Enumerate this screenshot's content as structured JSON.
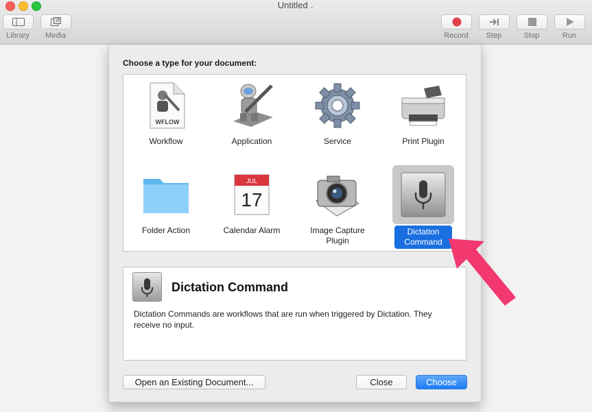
{
  "window": {
    "title": "Untitled"
  },
  "toolbar": {
    "library_label": "Library",
    "media_label": "Media",
    "record_label": "Record",
    "step_label": "Step",
    "stop_label": "Stop",
    "run_label": "Run"
  },
  "dialog": {
    "prompt": "Choose a type for your document:",
    "types": [
      {
        "label": "Workflow",
        "icon": "workflow-file-icon"
      },
      {
        "label": "Application",
        "icon": "automator-robot-icon"
      },
      {
        "label": "Service",
        "icon": "gear-icon"
      },
      {
        "label": "Print Plugin",
        "icon": "printer-icon"
      },
      {
        "label": "Folder Action",
        "icon": "folder-icon"
      },
      {
        "label": "Calendar Alarm",
        "icon": "calendar-icon",
        "month": "JUL",
        "day": "17"
      },
      {
        "label_line1": "Image Capture",
        "label_line2": "Plugin",
        "icon": "camera-icon"
      },
      {
        "label_line1": "Dictation",
        "label_line2": "Command",
        "icon": "microphone-icon",
        "selected": true
      }
    ],
    "description": {
      "title": "Dictation Command",
      "text": "Dictation Commands are workflows that are run when triggered by Dictation. They receive no input."
    },
    "buttons": {
      "open_existing": "Open an Existing Document...",
      "close": "Close",
      "choose": "Choose"
    }
  },
  "colors": {
    "accent": "#1a6fe0",
    "annotation_arrow": "#f2386f"
  }
}
